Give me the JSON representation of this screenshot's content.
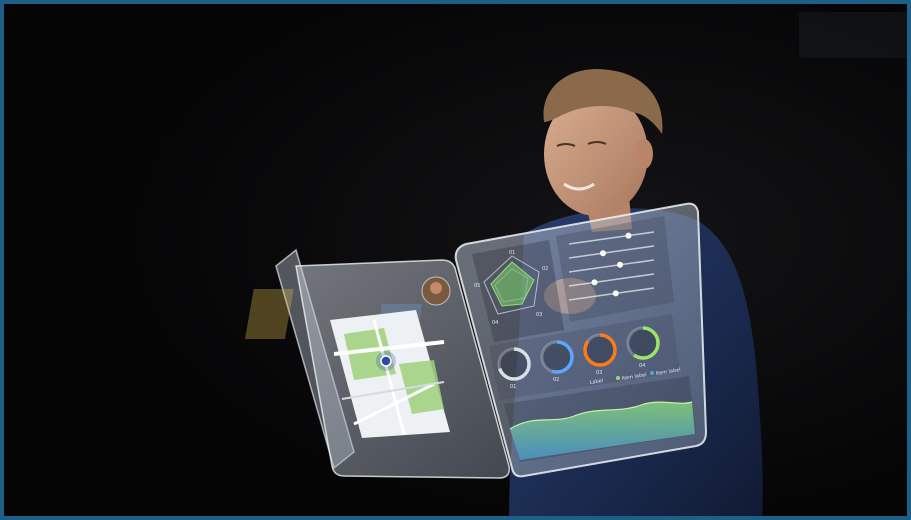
{
  "scene": {
    "accent_border": "#1d5f86",
    "background": "#050506",
    "jacket_color": "#1c2d52",
    "hair_color": "#8a6a4a",
    "skin_color": "#c99a7e"
  },
  "left_panel": {
    "map_pin_color": "#2c48a8",
    "map_green": "#9ed07a"
  },
  "right_panel": {
    "radar": {
      "labels": [
        "01",
        "02",
        "03",
        "04",
        "05"
      ]
    },
    "gauges": [
      {
        "label": "01",
        "color": "#d9dde4",
        "value": 0.7
      },
      {
        "label": "02",
        "color": "#5aa7ff",
        "value": 0.55
      },
      {
        "label": "03",
        "color": "#ff7a1a",
        "value": 0.85
      },
      {
        "label": "04",
        "color": "#9be36a",
        "value": 0.6
      }
    ],
    "sliders": [
      0.7,
      0.4,
      0.6,
      0.3,
      0.55
    ],
    "legend": [
      "Label",
      "Item label",
      "Item label"
    ]
  }
}
